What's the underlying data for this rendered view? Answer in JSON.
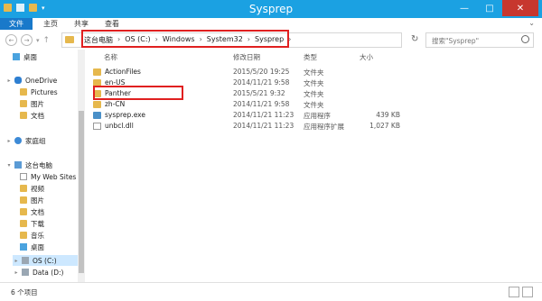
{
  "title": "Sysprep",
  "window_controls": {
    "minimize": "—",
    "maximize": "□",
    "close": "✕"
  },
  "ribbon_tabs": [
    "文件",
    "主页",
    "共享",
    "查看"
  ],
  "address": {
    "crumbs": [
      "这台电脑",
      "OS (C:)",
      "Windows",
      "System32",
      "Sysprep"
    ]
  },
  "search": {
    "placeholder": "搜索\"Sysprep\""
  },
  "columns": {
    "name": "名称",
    "date": "修改日期",
    "type": "类型",
    "size": "大小"
  },
  "files": [
    {
      "name": "ActionFiles",
      "date": "2015/5/20 19:25",
      "type": "文件夹",
      "size": "",
      "icon": "folder-icon"
    },
    {
      "name": "en-US",
      "date": "2014/11/21 9:58",
      "type": "文件夹",
      "size": "",
      "icon": "folder-icon"
    },
    {
      "name": "Panther",
      "date": "2015/5/21 9:32",
      "type": "文件夹",
      "size": "",
      "icon": "folder-icon"
    },
    {
      "name": "zh-CN",
      "date": "2014/11/21 9:58",
      "type": "文件夹",
      "size": "",
      "icon": "folder-icon"
    },
    {
      "name": "sysprep.exe",
      "date": "2014/11/21 11:23",
      "type": "应用程序",
      "size": "439 KB",
      "icon": "exe-icon"
    },
    {
      "name": "unbcl.dll",
      "date": "2014/11/21 11:23",
      "type": "应用程序扩展",
      "size": "1,027 KB",
      "icon": "dll-icon"
    }
  ],
  "sidebar": {
    "items": [
      {
        "label": "桌面"
      },
      {
        "label": "OneDrive"
      },
      {
        "label": "Pictures"
      },
      {
        "label": "图片"
      },
      {
        "label": "文档"
      },
      {
        "label": "家庭组"
      },
      {
        "label": "这台电脑"
      },
      {
        "label": "My Web Sites o"
      },
      {
        "label": "视频"
      },
      {
        "label": "图片"
      },
      {
        "label": "文档"
      },
      {
        "label": "下载"
      },
      {
        "label": "音乐"
      },
      {
        "label": "桌面"
      },
      {
        "label": "OS (C:)"
      },
      {
        "label": "Data (D:)"
      }
    ]
  },
  "status": {
    "count": "6 个项目"
  },
  "colors": {
    "accent": "#1ba1e2",
    "file_tab": "#1979ca",
    "highlight": "#e02020",
    "folder": "#e6b84d",
    "selected": "#cde8ff"
  }
}
